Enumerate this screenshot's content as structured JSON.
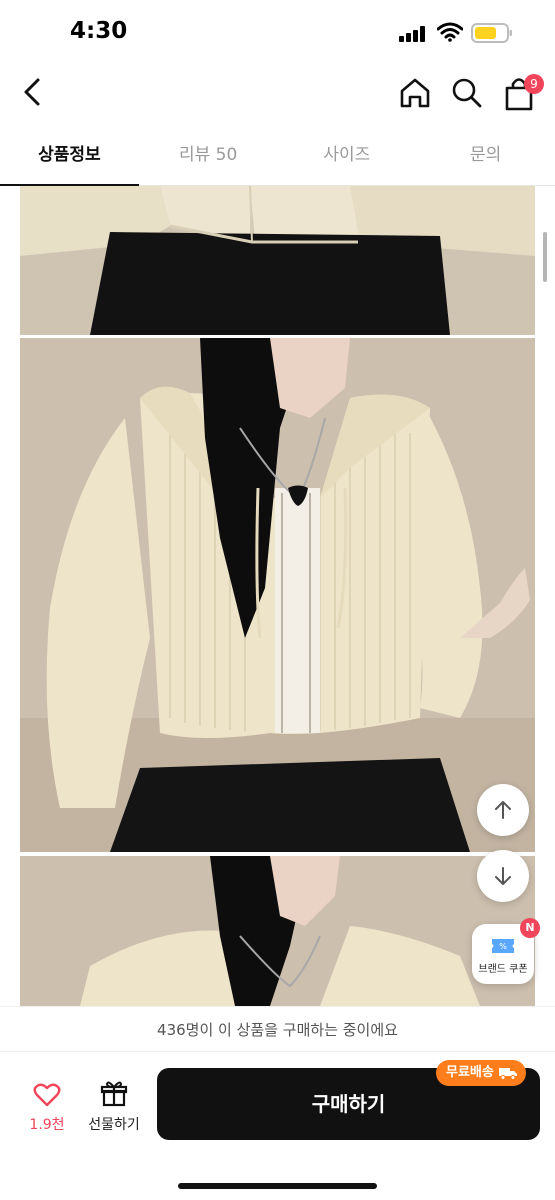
{
  "status_bar": {
    "time": "4:30"
  },
  "header": {
    "cart_count": "9",
    "icons": [
      "chevron-left-icon",
      "home-icon",
      "search-icon",
      "shopping-bag-icon"
    ]
  },
  "tabs": [
    {
      "label": "상품정보",
      "active": true
    },
    {
      "label": "리뷰 50",
      "active": false
    },
    {
      "label": "사이즈",
      "active": false
    },
    {
      "label": "문의",
      "active": false
    }
  ],
  "floating": {
    "coupon_label": "브랜드 쿠폰",
    "coupon_badge": "N"
  },
  "notice": {
    "text": "436명이 이 상품을 구매하는 중이에요"
  },
  "bottom_bar": {
    "like_count": "1.9천",
    "gift_label": "선물하기",
    "buy_label": "구매하기",
    "free_shipping": "무료배송"
  },
  "colors": {
    "accent_red": "#f0455b",
    "shipping_orange": "#ff7e1b",
    "buy_button": "#111111",
    "sweater_cream": "#eee4c9",
    "skirt_black": "#141414",
    "wall_beige": "#cdbfae"
  }
}
